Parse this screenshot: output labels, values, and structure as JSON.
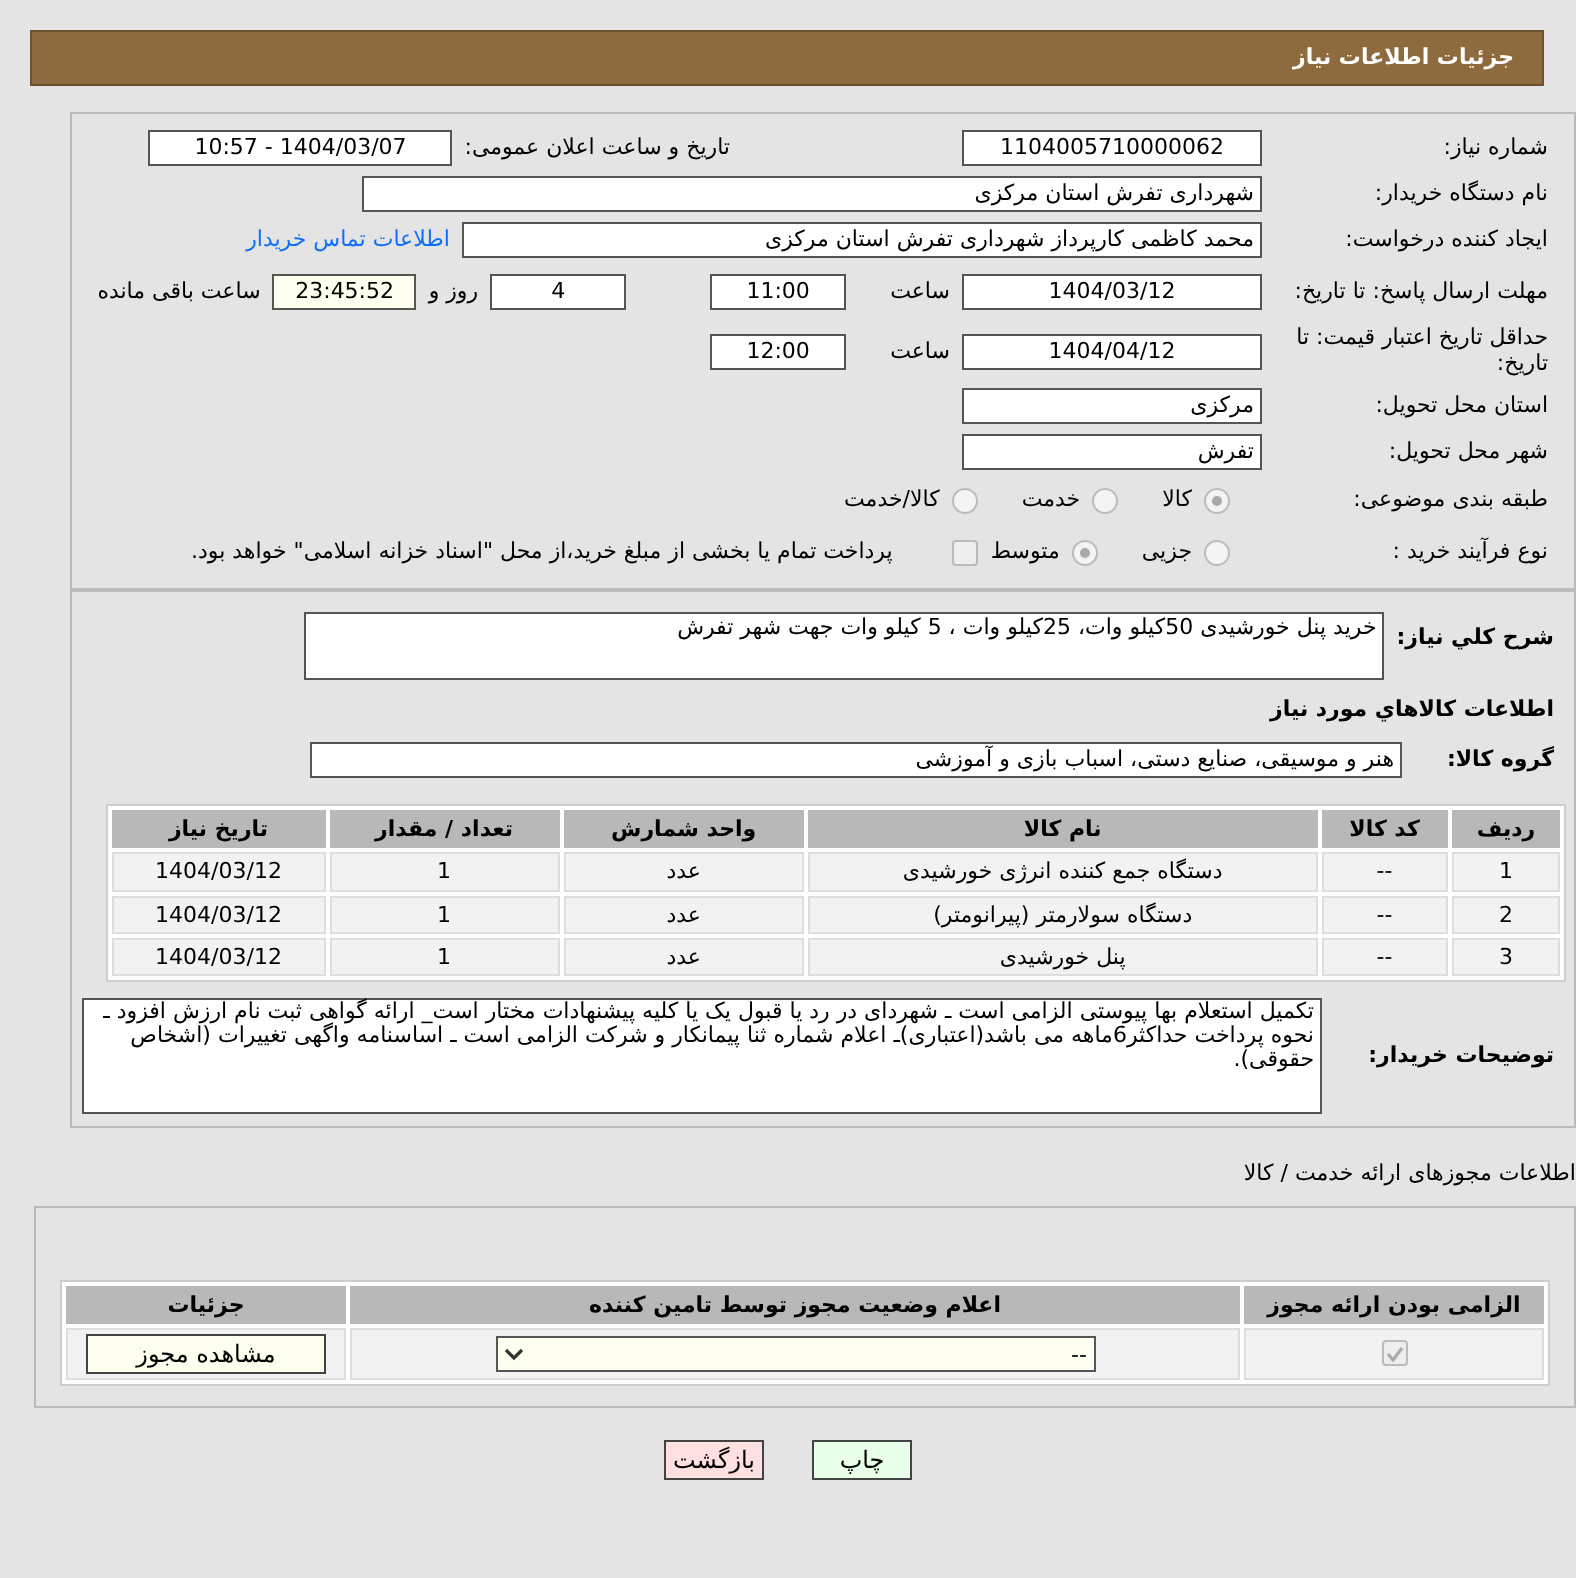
{
  "header": {
    "title": "جزئیات اطلاعات نیاز"
  },
  "need_number": {
    "label": "شماره نیاز:",
    "value": "1104005710000062"
  },
  "announce": {
    "label": "تاریخ و ساعت اعلان عمومی:",
    "value": "1404/03/07 - 10:57"
  },
  "buyer": {
    "label": "نام دستگاه خریدار:",
    "value": "شهرداری تفرش استان مرکزی"
  },
  "requester": {
    "label": "ایجاد کننده درخواست:",
    "value": "محمد کاظمی کارپرداز شهرداری تفرش استان مرکزی",
    "link": "اطلاعات تماس خریدار"
  },
  "deadline": {
    "label": "مهلت ارسال پاسخ: تا تاریخ:",
    "date": "1404/03/12",
    "time_label": "ساعت",
    "time": "11:00",
    "days": "4",
    "days_label": "روز و",
    "remaining": "23:45:52",
    "remaining_label": "ساعت باقی مانده"
  },
  "validity": {
    "label": "حداقل تاریخ اعتبار قیمت: تا تاریخ:",
    "date": "1404/04/12",
    "time_label": "ساعت",
    "time": "12:00"
  },
  "province": {
    "label": "استان محل تحویل:",
    "value": "مرکزی"
  },
  "city": {
    "label": "شهر محل تحویل:",
    "value": "تفرش"
  },
  "category": {
    "label": "طبقه بندی موضوعی:",
    "options": [
      {
        "label": "کالا",
        "selected": true
      },
      {
        "label": "خدمت",
        "selected": false
      },
      {
        "label": "کالا/خدمت",
        "selected": false
      }
    ]
  },
  "process": {
    "label": "نوع فرآیند خرید :",
    "options": [
      {
        "label": "جزیی",
        "selected": false
      },
      {
        "label": "متوسط",
        "selected": true
      }
    ],
    "payment": {
      "checked": false,
      "text": "پرداخت تمام یا بخشی از مبلغ خرید،از محل \"اسناد خزانه اسلامی\" خواهد بود."
    }
  },
  "description": {
    "label": "شرح کلي نياز:",
    "value": "خرید پنل خورشیدی 50کیلو وات، 25کیلو وات ، 5 کیلو وات جهت شهر تفرش"
  },
  "goods_title": "اطلاعات کالاهاي مورد نياز",
  "group": {
    "label": "گروه کالا:",
    "value": "هنر و موسیقی، صنایع دستی، اسباب بازی و آموزشی"
  },
  "items_table": {
    "columns": [
      "ردیف",
      "کد کالا",
      "نام کالا",
      "واحد شمارش",
      "تعداد / مقدار",
      "تاریخ نیاز"
    ],
    "rows": [
      [
        "1",
        "--",
        "دستگاه جمع کننده انرژی خورشیدی",
        "عدد",
        "1",
        "1404/03/12"
      ],
      [
        "2",
        "--",
        "دستگاه سولارمتر (پیرانومتر)",
        "عدد",
        "1",
        "1404/03/12"
      ],
      [
        "3",
        "--",
        "پنل خورشیدی",
        "عدد",
        "1",
        "1404/03/12"
      ]
    ]
  },
  "buyer_notes": {
    "label": "توضیحات خریدار:",
    "value": "تکمیل استعلام بها پیوستی الزامی است ـ شهردای در رد یا قبول یک یا کلیه پیشنهادات مختار است_ ارائه گواهی ثبت نام ارزش افزود ـ نحوه پرداخت حداکثر6ماهه می باشد(اعتباری)ـ اعلام شماره ثنا پیمانکار و شرکت الزامی است ـ اساسنامه واگهی تغییرات (اشخاص حقوقی)."
  },
  "permits": {
    "title": "اطلاعات مجوزهای ارائه خدمت / کالا",
    "columns": [
      "الزامی بودن ارائه مجوز",
      "اعلام وضعیت مجوز توسط تامین کننده",
      "جزئیات"
    ],
    "rows": [
      {
        "required": true,
        "status": "--",
        "details": "مشاهده مجوز"
      }
    ]
  },
  "buttons": [
    {
      "label": "چاپ",
      "kind": "print"
    },
    {
      "label": "بازگشت",
      "kind": "back"
    }
  ]
}
